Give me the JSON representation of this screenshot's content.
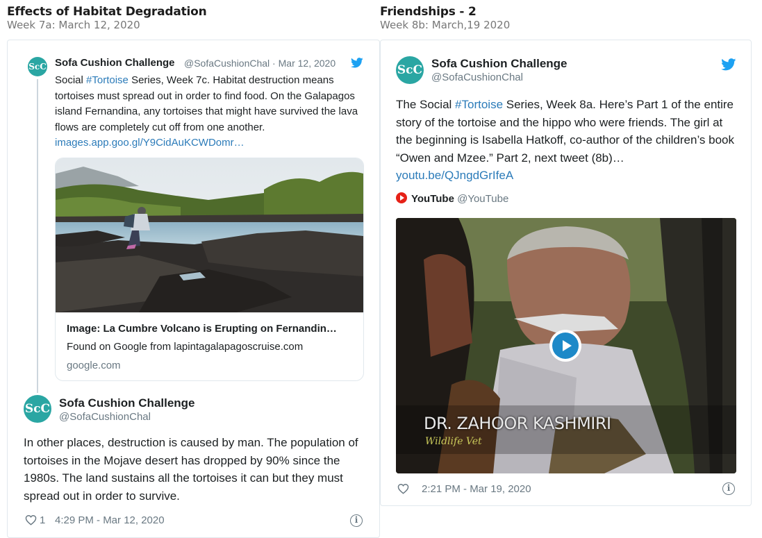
{
  "left": {
    "title": "Effects of Habitat Degradation",
    "subtitle": "Week 7a: March 12, 2020",
    "tweet1": {
      "avatar": "ScC",
      "name": "Sofa Cushion Challenge",
      "handle": "@SofaCushionChal",
      "separator": " · ",
      "date": "Mar 12, 2020",
      "text_pre": "Social ",
      "hashtag": "#Tortoise",
      "text_post": " Series, Week 7c. Habitat destruction means tortoises must spread out in order to find food. On the Galapagos island Fernandina, any tortoises that might have survived the lava flows are completely cut off from one another. ",
      "url": "images.app.goo.gl/Y9CidAuKCWDomr…",
      "card": {
        "title": "Image: La Cumbre Volcano is Erupting on Fernandin…",
        "description": "Found on Google from lapintagalapagoscruise.com",
        "domain": "google.com"
      }
    },
    "tweet2": {
      "avatar": "ScC",
      "name": "Sofa Cushion Challenge",
      "handle": "@SofaCushionChal",
      "text": "In other places, destruction is caused by man. The population of tortoises in the Mojave desert has dropped by 90% since the 1980s. The land sustains all the tortoises it can but they must spread out in order to survive.",
      "likes": "1",
      "timestamp": "4:29 PM - Mar 12, 2020"
    }
  },
  "right": {
    "title": "Friendships - 2",
    "subtitle": "Week 8b: March,19 2020",
    "tweet": {
      "avatar": "ScC",
      "name": "Sofa Cushion Challenge",
      "handle": "@SofaCushionChal",
      "text_pre": "The Social ",
      "hashtag": "#Tortoise",
      "text_post": " Series, Week 8a. Here’s Part 1 of the entire story of the tortoise and the hippo who were friends. The girl at the beginning is Isabella Hatkoff, co-author of the children’s book “Owen and Mzee.” Part 2, next tweet (8b)…",
      "url": "youtu.be/QJngdGrIfeA",
      "source_name": "YouTube",
      "source_handle": "@YouTube",
      "video_caption_line1": "DR. ZAHOOR KASHMIRI",
      "video_caption_line2": "Wildlife Vet",
      "timestamp": "2:21 PM - Mar 19, 2020"
    }
  },
  "colors": {
    "avatar": "#2aa6a3",
    "link": "#2b7bb9",
    "twitter_blue": "#1da1f2",
    "play_button": "#1d89c8",
    "youtube_red": "#e62117",
    "muted_text": "#697882"
  },
  "icons": [
    "twitter-bird-icon",
    "heart-icon",
    "info-icon",
    "play-icon",
    "youtube-icon"
  ]
}
